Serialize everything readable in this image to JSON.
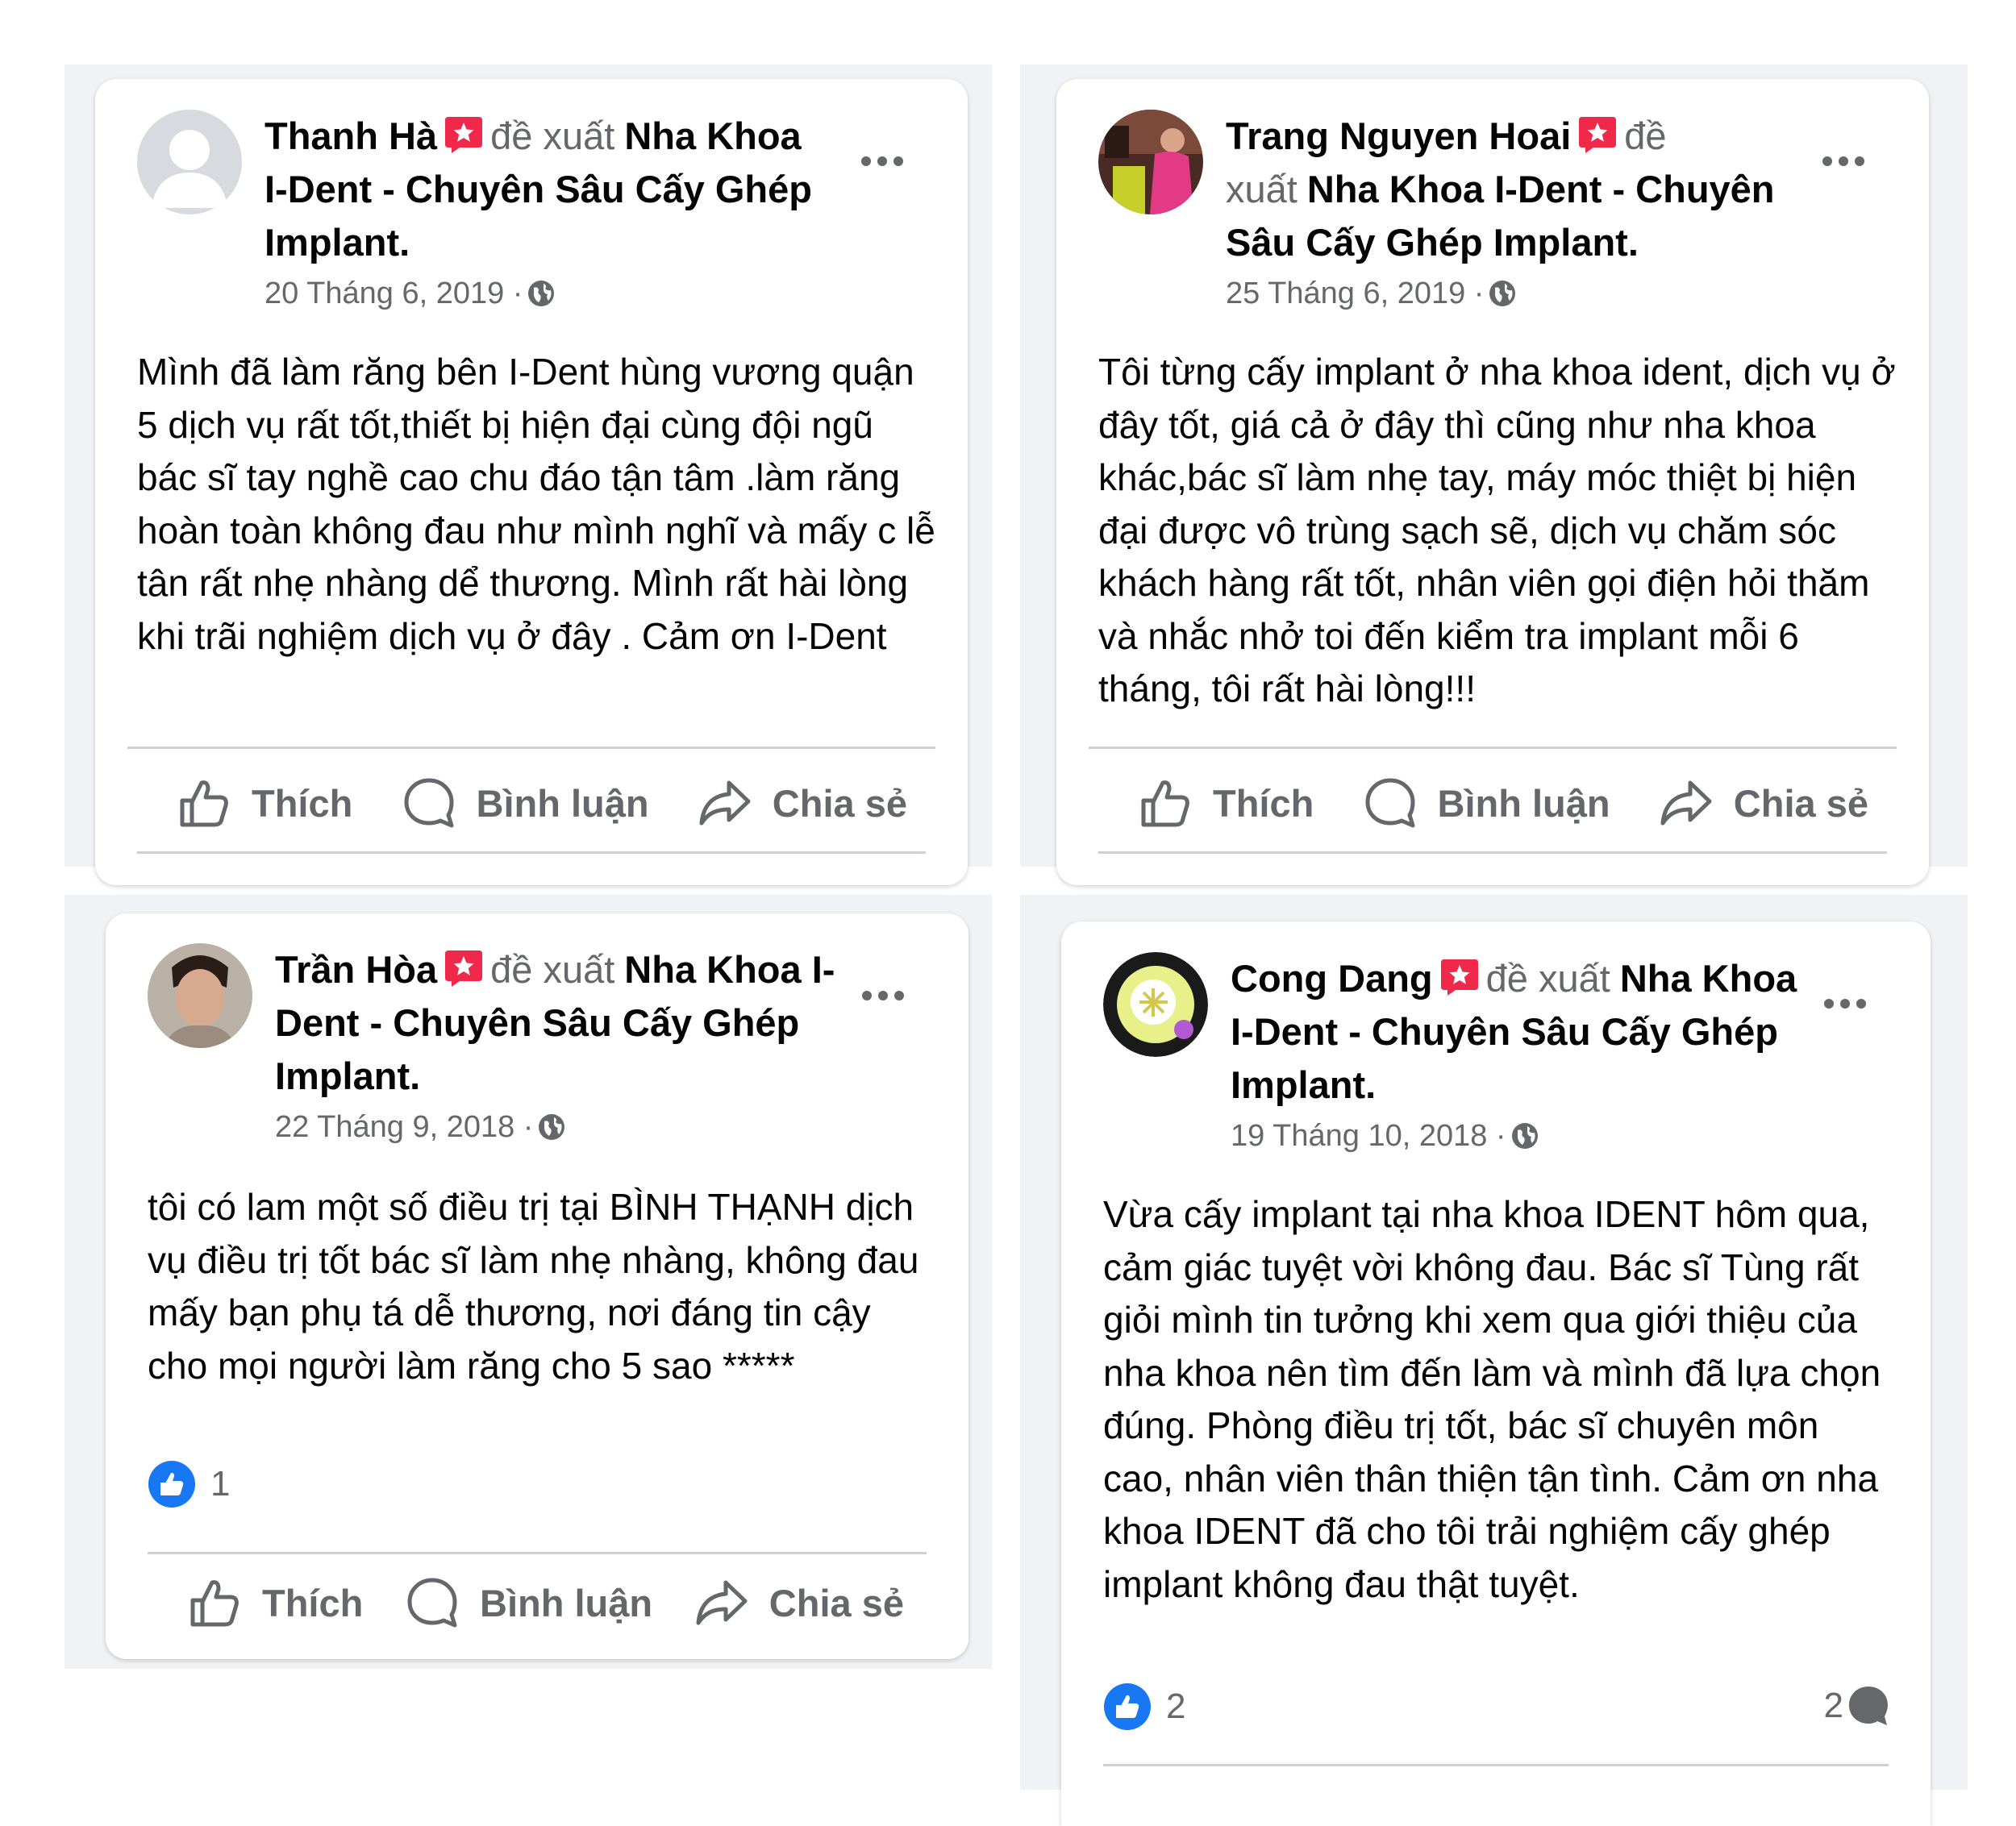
{
  "common": {
    "verb": "đề xuất",
    "page_name": "Nha Khoa I-Dent - Chuyên Sâu Cấy Ghép Implant.",
    "like_label": "Thích",
    "comment_label": "Bình luận",
    "share_label": "Chia sẻ"
  },
  "reviews": [
    {
      "author": "Thanh Hà",
      "date": "20 Tháng 6, 2019 ·",
      "text": "Mình đã làm răng bên I-Dent hùng vương quận 5 dịch vụ rất tốt,thiết bị hiện đại cùng đội ngũ bác sĩ tay nghề cao chu đáo tận tâm .làm răng hoàn toàn không đau như mình nghĩ và mấy c lễ tân rất nhẹ nhàng dể thương. Mình rất hài lòng khi trãi nghiệm dịch vụ ở đây . Cảm ơn I-Dent"
    },
    {
      "author": "Trang Nguyen Hoai",
      "date": "25 Tháng 6, 2019 ·",
      "text": "Tôi từng cấy implant ở nha khoa ident, dịch vụ ở đây tốt, giá cả ở đây thì cũng như nha khoa khác,bác sĩ làm nhẹ tay, máy móc thiệt bị hiện đại được vô trùng sạch sẽ, dịch vụ chăm sóc khách hàng rất tốt, nhân viên gọi điện hỏi thăm và nhắc nhở toi đến kiểm tra implant mỗi 6 tháng, tôi rất hài lòng!!!"
    },
    {
      "author": "Trần Hòa",
      "date": "22 Tháng 9, 2018 ·",
      "text": "tôi có lam một số điều trị tại BÌNH THẠNH dịch vụ điều trị tốt bác sĩ làm nhẹ nhàng, không đau mấy bạn phụ tá dễ thương, nơi đáng tin cậy cho mọi người làm răng cho 5 sao *****",
      "like_count": "1"
    },
    {
      "author": "Cong Dang",
      "date": "19 Tháng 10, 2018 ·",
      "text": "Vừa cấy implant tại nha khoa IDENT hôm qua, cảm giác tuyệt vời không đau. Bác sĩ Tùng rất giỏi mình tin tưởng khi xem qua giới thiệu của nha khoa nên tìm đến làm và mình đã lựa chọn đúng. Phòng điều trị tốt, bác sĩ chuyên môn cao, nhân viên thân thiện tận tình. Cảm ơn nha khoa IDENT   đã cho tôi trải nghiệm cấy ghép implant không đau thật tuyệt.",
      "like_count": "2",
      "comment_count": "2"
    }
  ],
  "colors": {
    "panel_bg": "#f0f2f5",
    "recommend_red": "#f02849",
    "like_blue": "#1877f2",
    "secondary_text": "#65676b"
  },
  "icons": [
    "recommend-icon",
    "globe-icon",
    "more-options-icon",
    "like-icon",
    "comment-icon",
    "share-icon",
    "like-reaction-icon",
    "comment-bubble-icon"
  ]
}
